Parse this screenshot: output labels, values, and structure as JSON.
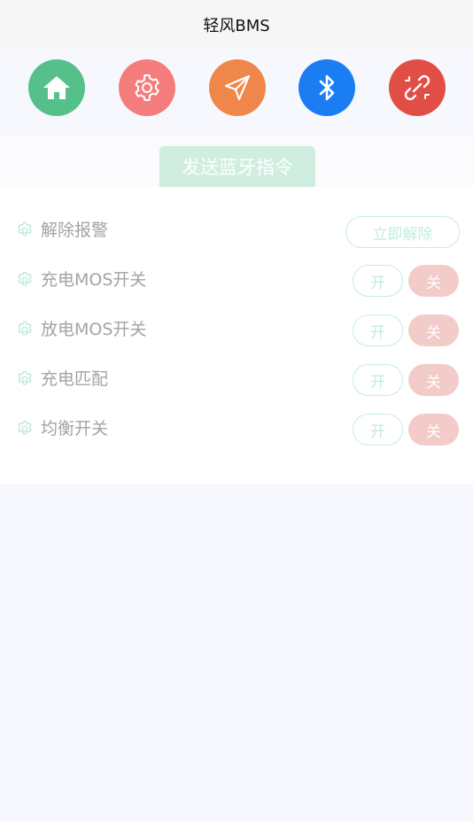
{
  "app": {
    "title": "轻风BMS"
  },
  "nav": {
    "items": [
      {
        "name": "home",
        "icon": "home-icon",
        "color": "#56c08a"
      },
      {
        "name": "settings",
        "icon": "gear-icon",
        "color": "#f57c7c"
      },
      {
        "name": "send",
        "icon": "paper-plane-icon",
        "color": "#f0874a"
      },
      {
        "name": "bluetooth",
        "icon": "bluetooth-icon",
        "color": "#1a7ef2"
      },
      {
        "name": "disconnect",
        "icon": "broken-link-icon",
        "color": "#e14e45"
      }
    ]
  },
  "section": {
    "tab_label": "发送蓝牙指令"
  },
  "commands": {
    "clear_alarm": {
      "label": "解除报警",
      "button": "立即解除"
    },
    "rows": [
      {
        "label": "充电MOS开关",
        "on": "开",
        "off": "关"
      },
      {
        "label": "放电MOS开关",
        "on": "开",
        "off": "关"
      },
      {
        "label": "充电匹配",
        "on": "开",
        "off": "关"
      },
      {
        "label": "均衡开关",
        "on": "开",
        "off": "关"
      }
    ]
  },
  "colors": {
    "accent_green": "#cfeee0",
    "off_button": "#f3cbc8",
    "label_gray": "#a3a3a3"
  }
}
